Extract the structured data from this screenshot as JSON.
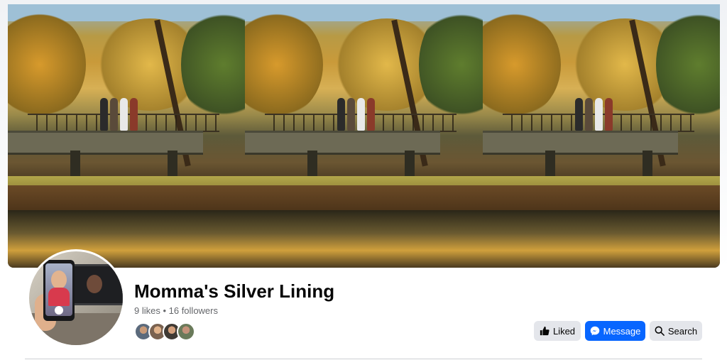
{
  "page": {
    "name": "Momma's Silver Lining",
    "stats": "9 likes • 16 followers"
  },
  "cover_photo": {
    "panels": 3
  },
  "actions": {
    "liked_label": "Liked",
    "message_label": "Message",
    "search_label": "Search"
  },
  "colors": {
    "primary_button": "#0866ff",
    "secondary_button": "#e4e6eb",
    "title_text": "#050505",
    "muted_text": "#65676b"
  },
  "icons": {
    "liked": "thumbs-up-icon",
    "message": "messenger-icon",
    "search": "search-icon"
  }
}
